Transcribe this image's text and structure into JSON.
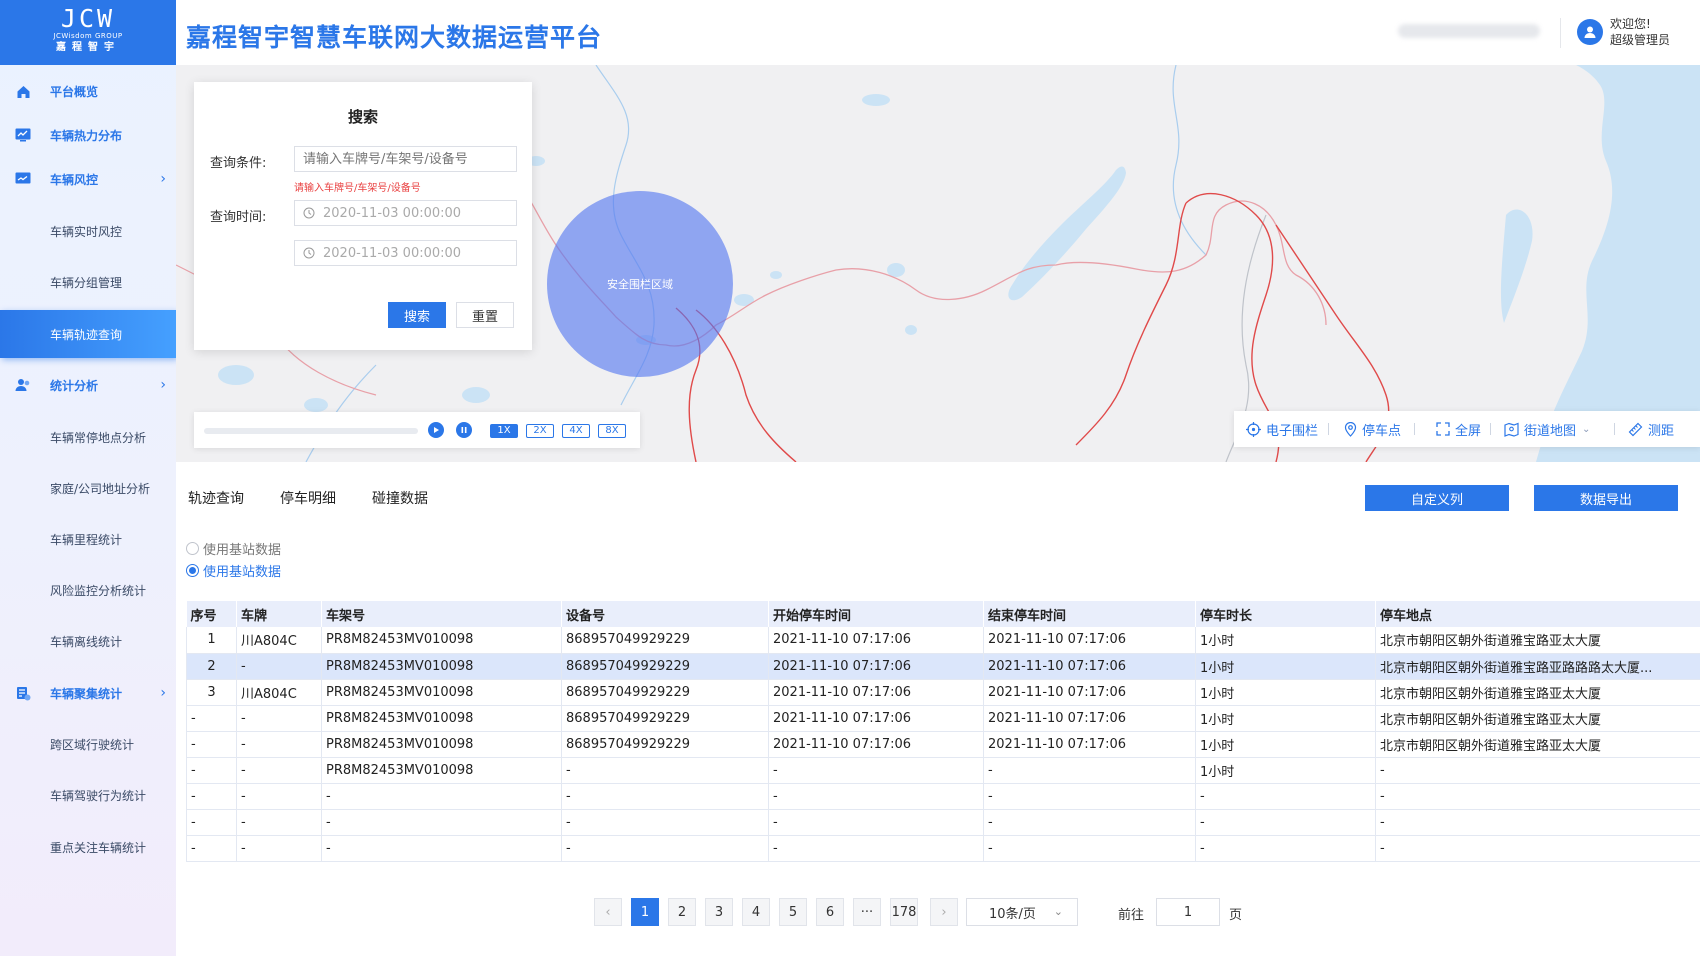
{
  "logo": {
    "mark": "JCW",
    "en": "JCWisdom GROUP",
    "cn": "嘉程智宇"
  },
  "sidebar": {
    "items": [
      {
        "label": "平台概览",
        "level": 1
      },
      {
        "label": "车辆热力分布",
        "level": 1
      },
      {
        "label": "车辆风控",
        "level": 1,
        "expandable": true
      },
      {
        "label": "车辆实时风控",
        "level": 2
      },
      {
        "label": "车辆分组管理",
        "level": 2
      },
      {
        "label": "车辆轨迹查询",
        "level": 2,
        "active": true
      },
      {
        "label": "统计分析",
        "level": 1,
        "expandable": true
      },
      {
        "label": "车辆常停地点分析",
        "level": 2
      },
      {
        "label": "家庭/公司地址分析",
        "level": 2
      },
      {
        "label": "车辆里程统计",
        "level": 2
      },
      {
        "label": "风险监控分析统计",
        "level": 2
      },
      {
        "label": "车辆离线统计",
        "level": 2
      },
      {
        "label": "车辆聚集统计",
        "level": 1,
        "expandable": true
      },
      {
        "label": "跨区域行驶统计",
        "level": 2
      },
      {
        "label": "车辆驾驶行为统计",
        "level": 2
      },
      {
        "label": "重点关注车辆统计",
        "level": 2
      }
    ]
  },
  "header": {
    "title": "嘉程智宇智慧车联网大数据运营平台",
    "welcome": "欢迎您!",
    "role": "超级管理员"
  },
  "map": {
    "fence_label": "安全围栏区域"
  },
  "search": {
    "title": "搜索",
    "condition_label": "查询条件:",
    "condition_placeholder": "请输入车牌号/车架号/设备号",
    "condition_error": "请输入车牌号/车架号/设备号",
    "time_label": "查询时间:",
    "start_time": "2020-11-03 00:00:00",
    "end_time": "2020-11-03 00:00:00",
    "search_button": "搜索",
    "reset_button": "重置"
  },
  "playback": {
    "progress": 0,
    "speeds": [
      "1X",
      "2X",
      "4X",
      "8X"
    ],
    "selected_speed": "1X"
  },
  "map_tools": {
    "fence": "电子围栏",
    "parking": "停车点",
    "fullscreen": "全屏",
    "street_map": "街道地图",
    "measure": "测距"
  },
  "tabs": [
    {
      "label": "轨迹查询",
      "active": false
    },
    {
      "label": "停车明细",
      "active": true
    },
    {
      "label": "碰撞数据",
      "active": false
    }
  ],
  "actions": {
    "custom_columns": "自定义列",
    "export": "数据导出"
  },
  "radios": [
    {
      "label": "使用基站数据",
      "checked": false
    },
    {
      "label": "使用基站数据",
      "checked": true
    }
  ],
  "table": {
    "columns": [
      "序号",
      "车牌",
      "车架号",
      "设备号",
      "开始停车时间",
      "结束停车时间",
      "停车时长",
      "停车地点"
    ],
    "rows": [
      [
        "1",
        "川A804C",
        "PR8M82453MV010098",
        "868957049929229",
        "2021-11-10 07:17:06",
        "2021-11-10 07:17:06",
        "1小时",
        "北京市朝阳区朝外街道雅宝路亚太大厦"
      ],
      [
        "2",
        "-",
        "PR8M82453MV010098",
        "868957049929229",
        "2021-11-10 07:17:06",
        "2021-11-10 07:17:06",
        "1小时",
        "北京市朝阳区朝外街道雅宝路亚路路路太大厦..."
      ],
      [
        "3",
        "川A804C",
        "PR8M82453MV010098",
        "868957049929229",
        "2021-11-10 07:17:06",
        "2021-11-10 07:17:06",
        "1小时",
        "北京市朝阳区朝外街道雅宝路亚太大厦"
      ],
      [
        "-",
        "-",
        "PR8M82453MV010098",
        "868957049929229",
        "2021-11-10 07:17:06",
        "2021-11-10 07:17:06",
        "1小时",
        "北京市朝阳区朝外街道雅宝路亚太大厦"
      ],
      [
        "-",
        "-",
        "PR8M82453MV010098",
        "868957049929229",
        "2021-11-10 07:17:06",
        "2021-11-10 07:17:06",
        "1小时",
        "北京市朝阳区朝外街道雅宝路亚太大厦"
      ],
      [
        "-",
        "-",
        "PR8M82453MV010098",
        "-",
        "-",
        "-",
        "1小时",
        "-"
      ],
      [
        "-",
        "-",
        "-",
        "-",
        "-",
        "-",
        "-",
        "-"
      ],
      [
        "-",
        "-",
        "-",
        "-",
        "-",
        "-",
        "-",
        "-"
      ],
      [
        "-",
        "-",
        "-",
        "-",
        "-",
        "-",
        "-",
        "-"
      ]
    ],
    "selected_row": 1
  },
  "pagination": {
    "pages": [
      "1",
      "2",
      "3",
      "4",
      "5",
      "6",
      "···",
      "178"
    ],
    "current": "1",
    "page_size": "10条/页",
    "goto_label": "前往",
    "goto_value": "1",
    "page_suffix": "页"
  },
  "colors": {
    "primary": "#2b77e8",
    "fence": "#5478f0",
    "error": "#e94040",
    "selected_row": "#dbe6fb"
  }
}
